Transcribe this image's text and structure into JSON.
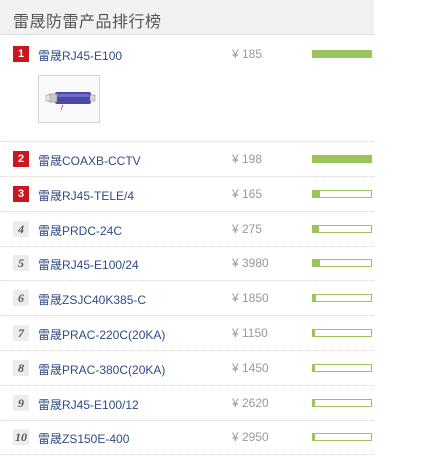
{
  "header": {
    "title": "雷晟防雷产品排行榜"
  },
  "items": [
    {
      "rank": "1",
      "name": "雷晟RJ45-E100",
      "price": "¥ 185",
      "popularity": 1.0,
      "top": true
    },
    {
      "rank": "2",
      "name": "雷晟COAXB-CCTV",
      "price": "¥ 198",
      "popularity": 1.0,
      "top": true
    },
    {
      "rank": "3",
      "name": "雷晟RJ45-TELE/4",
      "price": "¥ 165",
      "popularity": 0.12,
      "top": true
    },
    {
      "rank": "4",
      "name": "雷晟PRDC-24C",
      "price": "¥ 275",
      "popularity": 0.1,
      "top": false
    },
    {
      "rank": "5",
      "name": "雷晟RJ45-E100/24",
      "price": "¥ 3980",
      "popularity": 0.12,
      "top": false
    },
    {
      "rank": "6",
      "name": "雷晟ZSJC40K385-C",
      "price": "¥ 1850",
      "popularity": 0.05,
      "top": false
    },
    {
      "rank": "7",
      "name": "雷晟PRAC-220C(20KA)",
      "price": "¥ 1150",
      "popularity": 0.03,
      "top": false
    },
    {
      "rank": "8",
      "name": "雷晟PRAC-380C(20KA)",
      "price": "¥ 1450",
      "popularity": 0.03,
      "top": false
    },
    {
      "rank": "9",
      "name": "雷晟RJ45-E100/12",
      "price": "¥ 2620",
      "popularity": 0.03,
      "top": false
    },
    {
      "rank": "10",
      "name": "雷晟ZS150E-400",
      "price": "¥ 2950",
      "popularity": 0.03,
      "top": false
    }
  ],
  "colors": {
    "rank_top": "#c8171e",
    "bar": "#9bc45a",
    "link": "#2f4c86"
  }
}
